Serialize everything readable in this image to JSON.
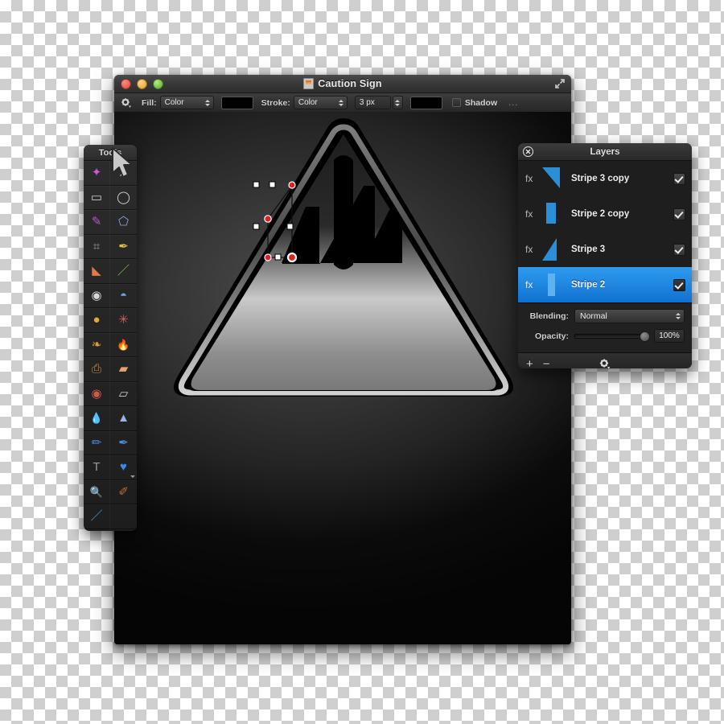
{
  "window": {
    "title": "Caution Sign",
    "proxy_icon": "document-image-icon",
    "traffic_lights": [
      {
        "name": "close",
        "color": "#e0443a"
      },
      {
        "name": "minimize",
        "color": "#e0a02a"
      },
      {
        "name": "zoom",
        "color": "#4fae2c"
      }
    ],
    "expand_icon": "fullscreen-expand-icon"
  },
  "toolbar": {
    "settings_icon": "gear-icon",
    "fill_label": "Fill:",
    "fill_value": "Color",
    "fill_swatch_color": "#000000",
    "stroke_label": "Stroke:",
    "stroke_value": "Color",
    "stroke_width": "3 px",
    "stroke_swatch_color": "#000000",
    "shadow_label": "Shadow",
    "shadow_checked": false,
    "more_label": "..."
  },
  "tools": {
    "title": "Tools",
    "cursor_icon": "arrow-pointer-cursor",
    "items": [
      {
        "name": "magic-wand-tool",
        "glyph": "✦"
      },
      {
        "name": "move-selection-tool",
        "glyph": "➤"
      },
      {
        "name": "rectangular-marquee-tool",
        "glyph": "▭"
      },
      {
        "name": "elliptical-marquee-tool",
        "glyph": "◯"
      },
      {
        "name": "freehand-selection-tool",
        "glyph": "✎"
      },
      {
        "name": "polygon-lasso-tool",
        "glyph": "⬠"
      },
      {
        "name": "crop-tool",
        "glyph": "⌗"
      },
      {
        "name": "pen-tool",
        "glyph": "✒"
      },
      {
        "name": "eraser-tool",
        "glyph": "◣"
      },
      {
        "name": "paintbrush-tool",
        "glyph": "／"
      },
      {
        "name": "camera-effects-tool",
        "glyph": "◉"
      },
      {
        "name": "paint-bucket-tool",
        "glyph": "◓"
      },
      {
        "name": "burn-dodge-tool",
        "glyph": "●"
      },
      {
        "name": "color-splash-tool",
        "glyph": "✳"
      },
      {
        "name": "smudge-tool",
        "glyph": "❧"
      },
      {
        "name": "blur-flame-tool",
        "glyph": "🔥"
      },
      {
        "name": "clone-stamp-tool",
        "glyph": "⎙"
      },
      {
        "name": "bandage-healing-tool",
        "glyph": "▰"
      },
      {
        "name": "red-eye-tool",
        "glyph": "◉"
      },
      {
        "name": "eraser-block-tool",
        "glyph": "▱"
      },
      {
        "name": "water-drop-tool",
        "glyph": "💧"
      },
      {
        "name": "gradient-cone-tool",
        "glyph": "▲"
      },
      {
        "name": "pencil-tool",
        "glyph": "✏"
      },
      {
        "name": "ink-pen-tool",
        "glyph": "✒"
      },
      {
        "name": "text-tool",
        "glyph": "T"
      },
      {
        "name": "shape-heart-tool",
        "glyph": "♥"
      },
      {
        "name": "zoom-tool",
        "glyph": "🔍"
      },
      {
        "name": "eyedropper-tool",
        "glyph": "✐"
      },
      {
        "name": "brush-stroke-tool",
        "glyph": "／"
      }
    ]
  },
  "layers": {
    "title": "Layers",
    "close_icon": "close-circle-icon",
    "items": [
      {
        "fx": "fx",
        "name": "Stripe 3 copy",
        "visible": true,
        "selected": false,
        "thumb": "blue-stripe-thumb-1"
      },
      {
        "fx": "fx",
        "name": "Stripe 2 copy",
        "visible": true,
        "selected": false,
        "thumb": "blue-stripe-thumb-2"
      },
      {
        "fx": "fx",
        "name": "Stripe 3",
        "visible": true,
        "selected": false,
        "thumb": "blue-stripe-thumb-3"
      },
      {
        "fx": "fx",
        "name": "Stripe 2",
        "visible": true,
        "selected": true,
        "thumb": "blue-stripe-thumb-4"
      }
    ],
    "blending_label": "Blending:",
    "blending_value": "Normal",
    "opacity_label": "Opacity:",
    "opacity_value": "100%",
    "opacity_percent": 100,
    "add_label": "+",
    "remove_label": "−",
    "action_icon": "gear-icon",
    "selection_color": "#1e8ae0",
    "thumb_color": "#2b8fd8"
  },
  "artwork": {
    "name": "caution-sign-triangle",
    "description": "rounded black triangle caution sign with exclamation mark stripes"
  }
}
